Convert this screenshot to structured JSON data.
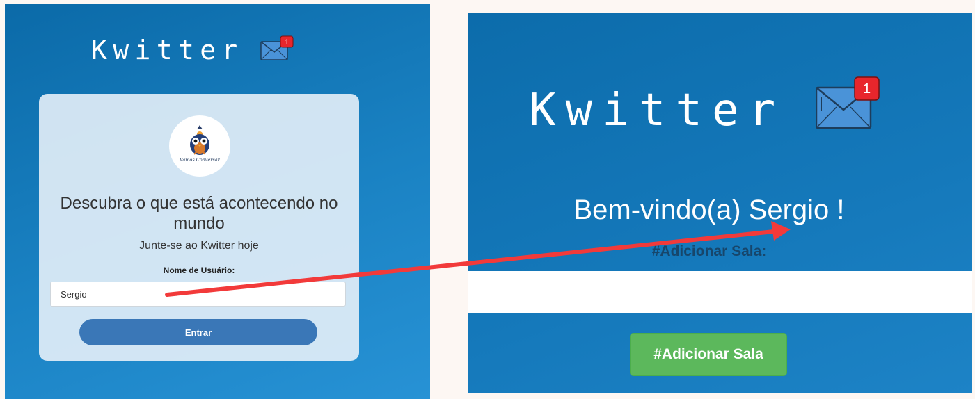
{
  "left_screen": {
    "brand": {
      "title": "Kwitter",
      "notification_count": "1"
    },
    "logo": {
      "caption": "Vamos Conversar"
    },
    "card": {
      "heading": "Descubra o que está acontecendo no mundo",
      "subheading": "Junte-se ao Kwitter hoje",
      "username_label": "Nome de Usuário:",
      "username_value": "Sergio",
      "enter_button": "Entrar"
    }
  },
  "right_screen": {
    "brand": {
      "title": "Kwitter",
      "notification_count": "1"
    },
    "welcome": "Bem-vindo(a) Sergio !",
    "room_label": "#Adicionar Sala:",
    "room_input_value": "",
    "add_room_button": "#Adicionar Sala"
  },
  "colors": {
    "panel_blue": "#1579bb",
    "card_bg": "#e6f0f8",
    "enter_button": "#3a77b7",
    "add_room_button": "#5cb85c",
    "arrow": "#f23a3a",
    "badge": "#e8262c",
    "envelope": "#4a93d8"
  },
  "icons": {
    "mail": "envelope-notification-icon",
    "logo": "blue-bird-icon",
    "arrow": "red-arrow-annotation"
  }
}
